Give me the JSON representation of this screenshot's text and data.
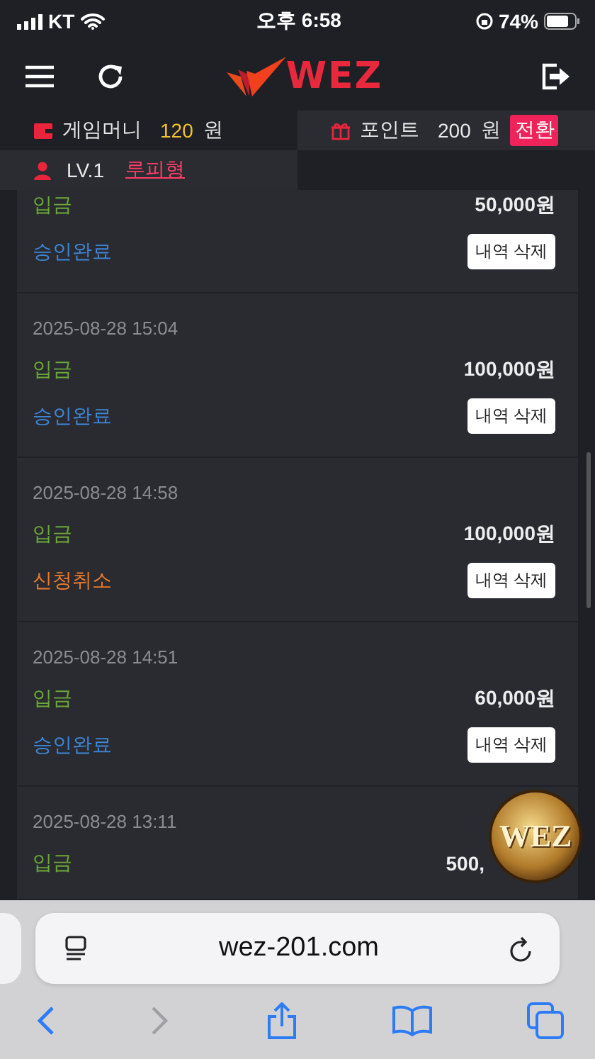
{
  "status_bar": {
    "carrier": "KT",
    "time": "오후 6:58",
    "battery": "74%"
  },
  "header": {
    "logo": "WEZ"
  },
  "wallet": {
    "money_label": "게임머니",
    "money_value": "120",
    "money_unit": "원",
    "point_label": "포인트",
    "point_value": "200",
    "point_unit": "원",
    "convert_button": "전환",
    "level": "LV.1",
    "nickname": "루피형"
  },
  "history": [
    {
      "type": "입금",
      "amount": "50,000원",
      "status": "승인완료",
      "color": "#3d86d8",
      "button": "내역 삭제"
    },
    {
      "date": "2025-08-28 15:04",
      "type": "입금",
      "amount": "100,000원",
      "status": "승인완료",
      "color": "#3d86d8",
      "button": "내역 삭제"
    },
    {
      "date": "2025-08-28 14:58",
      "type": "입금",
      "amount": "100,000원",
      "status": "신청취소",
      "color": "#ea7a2c",
      "button": "내역 삭제"
    },
    {
      "date": "2025-08-28 14:51",
      "type": "입금",
      "amount": "60,000원",
      "status": "승인완료",
      "color": "#3d86d8",
      "button": "내역 삭제"
    },
    {
      "date": "2025-08-28 13:11",
      "type": "입금",
      "amount": "500,"
    }
  ],
  "badge": {
    "text": "WEZ"
  },
  "browser": {
    "url": "wez-201.com"
  }
}
